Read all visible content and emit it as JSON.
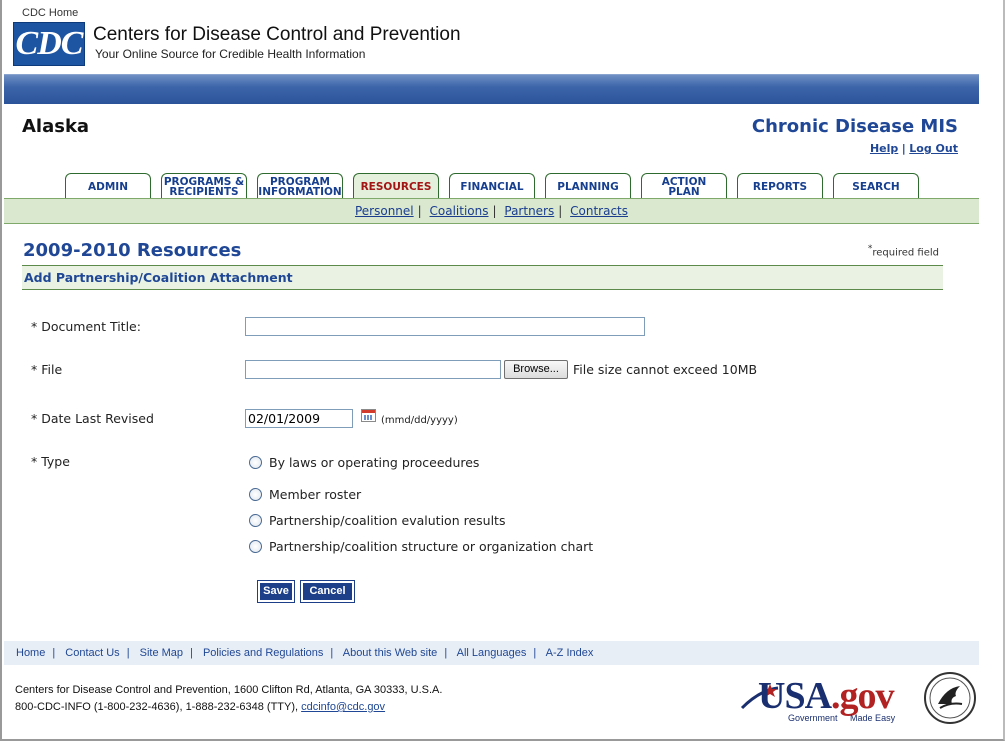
{
  "header": {
    "cdc_home": "CDC Home",
    "logo_text": "CDC",
    "org_name": "Centers for Disease Control and Prevention",
    "tagline": "Your Online Source for Credible Health Information"
  },
  "top": {
    "state": "Alaska",
    "system_title": "Chronic Disease MIS",
    "help": "Help",
    "logout": "Log Out"
  },
  "tabs": [
    {
      "line1": "ADMIN",
      "line2": ""
    },
    {
      "line1": "PROGRAMS &",
      "line2": "RECIPIENTS"
    },
    {
      "line1": "PROGRAM",
      "line2": "INFORMATION"
    },
    {
      "line1": "RESOURCES",
      "line2": ""
    },
    {
      "line1": "FINANCIAL",
      "line2": ""
    },
    {
      "line1": "PLANNING",
      "line2": ""
    },
    {
      "line1": "ACTION",
      "line2": "PLAN"
    },
    {
      "line1": "REPORTS",
      "line2": ""
    },
    {
      "line1": "SEARCH",
      "line2": ""
    }
  ],
  "subnav": [
    "Personnel",
    "Coalitions",
    "Partners",
    "Contracts"
  ],
  "page": {
    "title": "2009-2010 Resources",
    "required_asterisk": "*",
    "required_text": "required field",
    "section": "Add Partnership/Coalition Attachment"
  },
  "form": {
    "doc_title_label": "* Document Title:",
    "doc_title_value": "",
    "file_label": "* File",
    "file_value": "",
    "browse": "Browse...",
    "file_hint": "File size cannot exceed 10MB",
    "date_label": "* Date Last Revised",
    "date_value": "02/01/2009",
    "date_hint": "(mmd/dd/yyyy)",
    "type_label": "* Type",
    "types": [
      "By laws or operating proceedures",
      "Member roster",
      "Partnership/coalition evalution results",
      "Partnership/coalition structure or organization chart"
    ],
    "save": "Save",
    "cancel": "Cancel"
  },
  "footer": {
    "links": [
      "Home",
      "Contact Us",
      "Site Map",
      "Policies and Regulations",
      "About this Web site",
      "All Languages",
      "A-Z Index"
    ],
    "address": "Centers for Disease Control and Prevention, 1600 Clifton Rd, Atlanta, GA 30333, U.S.A.",
    "phone": "800-CDC-INFO (1-800-232-4636), 1-888-232-6348 (TTY),",
    "email": "cdcinfo@cdc.gov",
    "usa_logo_main": "USA",
    "usa_logo_gov": ".gov",
    "usa_logo_sub1": "Government",
    "usa_logo_sub2": "Made Easy"
  },
  "colors": {
    "brand_blue": "#1f4795",
    "tab_active_text": "#a31515",
    "subnav_bg": "#d9e8cf",
    "button_bg": "#1d3f8a"
  }
}
